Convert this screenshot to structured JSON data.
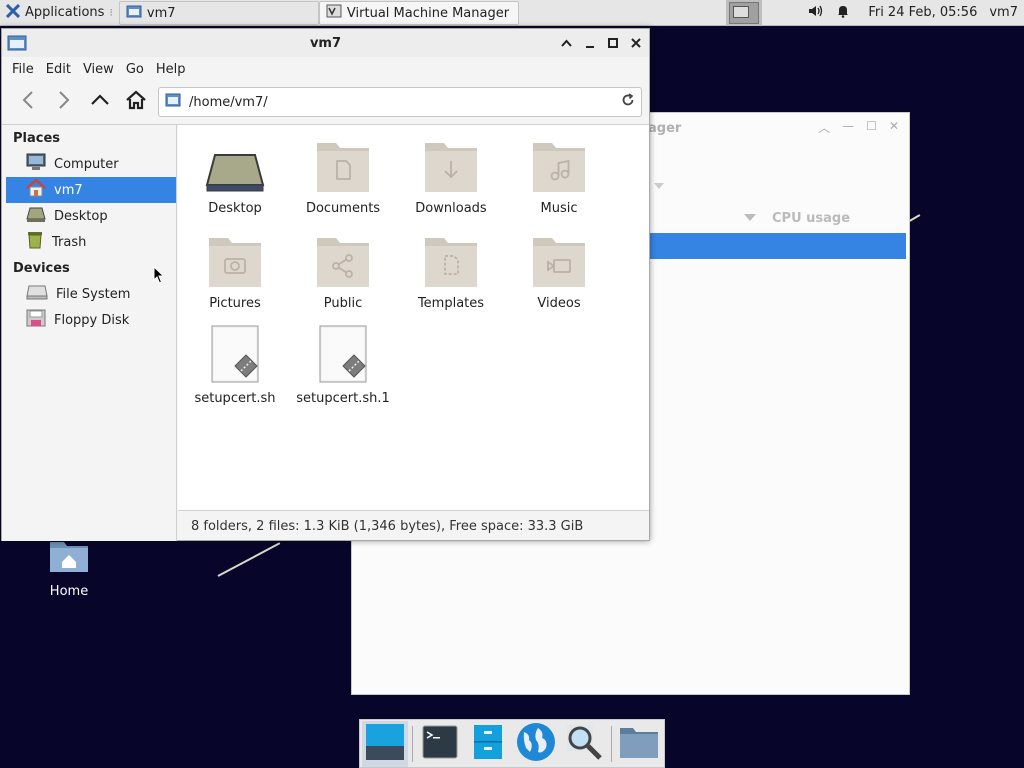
{
  "panel": {
    "apps_label": "Applications",
    "tasks": [
      {
        "label": "vm7"
      },
      {
        "label": "Virtual Machine Manager"
      }
    ],
    "clock": "Fri 24 Feb, 05:56",
    "user": "vm7"
  },
  "desktop": {
    "icons": [
      {
        "label": "Home"
      }
    ]
  },
  "bg_window": {
    "title_fragment": "ager",
    "column_header": "CPU usage"
  },
  "window": {
    "title": "vm7",
    "menu": [
      "File",
      "Edit",
      "View",
      "Go",
      "Help"
    ],
    "address": "/home/vm7/",
    "sidebar": {
      "sections": [
        {
          "title": "Places",
          "items": [
            {
              "label": "Computer",
              "icon": "computer-icon"
            },
            {
              "label": "vm7",
              "icon": "home-icon",
              "selected": true
            },
            {
              "label": "Desktop",
              "icon": "desktop-icon"
            },
            {
              "label": "Trash",
              "icon": "trash-icon"
            }
          ]
        },
        {
          "title": "Devices",
          "items": [
            {
              "label": "File System",
              "icon": "drive-icon"
            },
            {
              "label": "Floppy Disk",
              "icon": "floppy-icon"
            }
          ]
        }
      ]
    },
    "files": [
      {
        "label": "Desktop",
        "icon": "desktop-folder-icon"
      },
      {
        "label": "Documents",
        "icon": "documents-folder-icon"
      },
      {
        "label": "Downloads",
        "icon": "downloads-folder-icon"
      },
      {
        "label": "Music",
        "icon": "music-folder-icon"
      },
      {
        "label": "Pictures",
        "icon": "pictures-folder-icon"
      },
      {
        "label": "Public",
        "icon": "public-folder-icon"
      },
      {
        "label": "Templates",
        "icon": "templates-folder-icon"
      },
      {
        "label": "Videos",
        "icon": "videos-folder-icon"
      },
      {
        "label": "setupcert.sh",
        "icon": "script-file-icon"
      },
      {
        "label": "setupcert.sh.1",
        "icon": "script-file-icon"
      }
    ],
    "status": "8 folders, 2 files: 1.3 KiB (1,346 bytes), Free space: 33.3 GiB"
  },
  "colors": {
    "selection": "#3584e4",
    "desktop_bg": "#07062a",
    "folder": "#d8d2c8"
  }
}
